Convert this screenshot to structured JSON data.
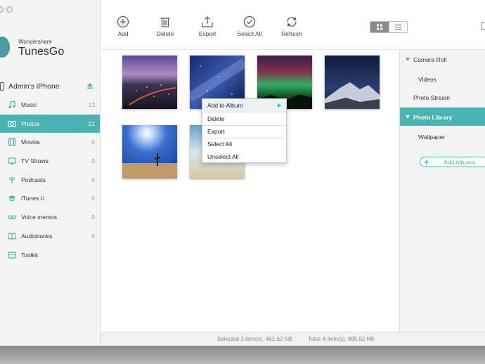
{
  "app": {
    "brand_small": "Wondershare",
    "brand_name": "TunesGo"
  },
  "device": {
    "name": "Admin's iPhone"
  },
  "sidebar": {
    "items": [
      {
        "label": "Music",
        "count": "13",
        "icon": "music-note-icon"
      },
      {
        "label": "Photos",
        "count": "21",
        "icon": "camera-icon",
        "active": true
      },
      {
        "label": "Movies",
        "count": "0",
        "icon": "film-icon"
      },
      {
        "label": "TV Shows",
        "count": "0",
        "icon": "tv-icon"
      },
      {
        "label": "Podcasts",
        "count": "0",
        "icon": "podcast-icon"
      },
      {
        "label": "iTunes U",
        "count": "0",
        "icon": "graduation-cap-icon"
      },
      {
        "label": "Voice memos",
        "count": "0",
        "icon": "voicemail-icon"
      },
      {
        "label": "Audiobooks",
        "count": "0",
        "icon": "book-icon"
      },
      {
        "label": "Toolkit",
        "count": "",
        "icon": "toolkit-icon"
      }
    ]
  },
  "toolbar": {
    "add_label": "Add",
    "delete_label": "Delete",
    "export_label": "Export",
    "select_all_label": "Select All",
    "refresh_label": "Refresh"
  },
  "context_menu": {
    "items": [
      "Add to Album",
      "Delete",
      "Export",
      "Select All",
      "Unselect All"
    ]
  },
  "right_panel": {
    "camera_roll": "Camera Roll",
    "videos": "Videos",
    "photo_stream": "Photo Stream",
    "photo_library": "Photo Library",
    "wallpaper": "Wallpaper",
    "add_albums": "Add Albums"
  },
  "status": {
    "selected": "Selected 3 item(s), 461.62 KB",
    "total": "Total: 6 item(s), 995.92 KB"
  },
  "colors": {
    "accent": "#4ab3b3",
    "sidebar_bg": "#f4f4f4"
  }
}
